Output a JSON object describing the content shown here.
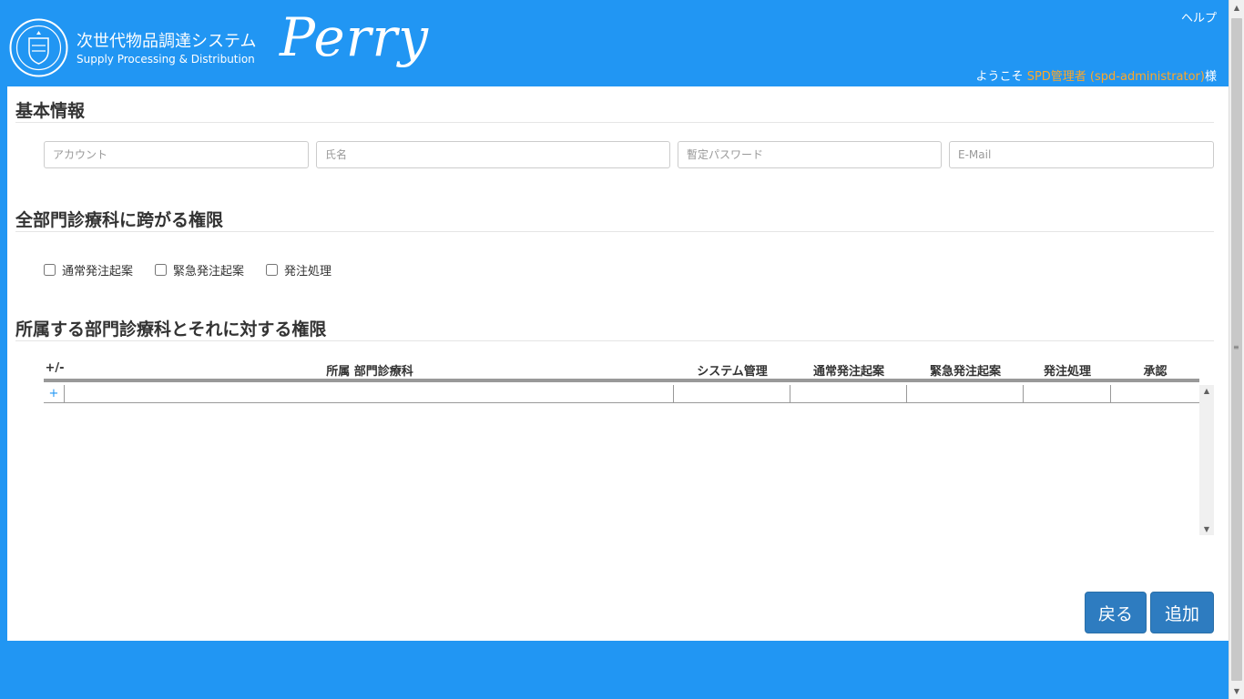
{
  "header": {
    "system_title": "次世代物品調達システム",
    "system_subtitle": "Supply Processing & Distribution",
    "brand": "Perry",
    "help_link": "ヘルプ",
    "welcome_prefix": "ようこそ",
    "user_name": "SPD管理者 (spd-administrator)",
    "welcome_suffix": "様"
  },
  "basic_info": {
    "title": "基本情報",
    "account_placeholder": "アカウント",
    "name_placeholder": "氏名",
    "password_placeholder": "暫定パスワード",
    "email_placeholder": "E-Mail"
  },
  "global_permissions": {
    "title": "全部門診療科に跨がる権限",
    "options": [
      "通常発注起案",
      "緊急発注起案",
      "発注処理"
    ]
  },
  "dept_permissions": {
    "title": "所属する部門診療科とそれに対する権限",
    "columns": {
      "add_remove": "+/-",
      "department": "所属 部門診療科",
      "system_admin": "システム管理",
      "normal_order": "通常発注起案",
      "urgent_order": "緊急発注起案",
      "order_processing": "発注処理",
      "approval": "承認"
    },
    "add_row_label": "+"
  },
  "actions": {
    "back_label": "戻る",
    "add_label": "追加"
  },
  "colors": {
    "brand_blue": "#2196F3",
    "button_blue": "#2E7CC0",
    "user_orange": "#FFA726"
  }
}
